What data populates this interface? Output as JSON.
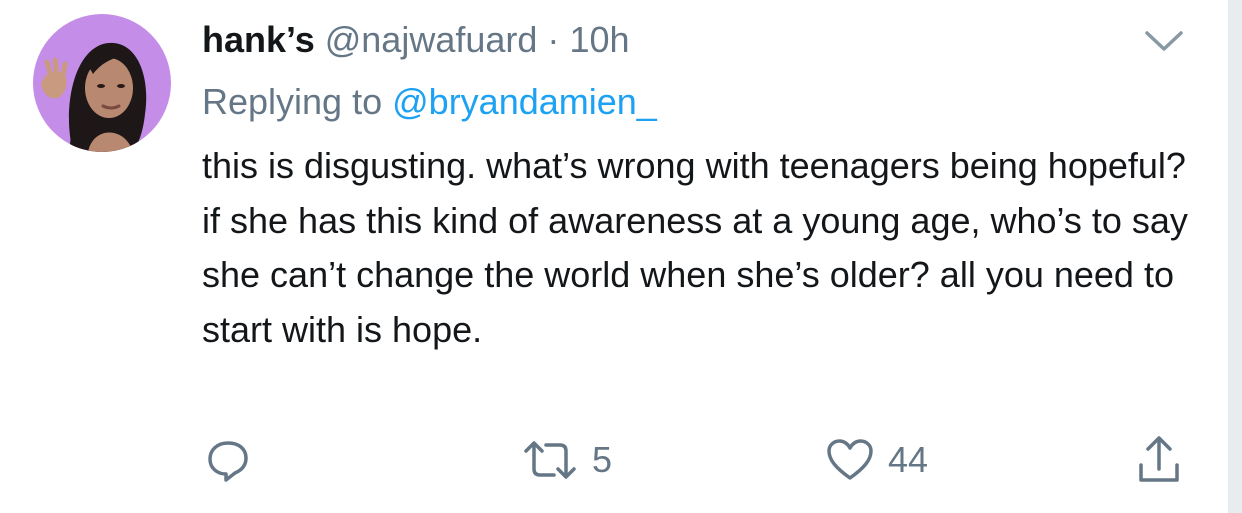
{
  "tweet": {
    "display_name": "hank’s",
    "handle": "@najwafuard",
    "separator": "·",
    "time": "10h",
    "replying_prefix": "Replying to",
    "replying_mention": "@bryandamien_",
    "text": "this is disgusting. what’s wrong with teenagers being hopeful? if she has this kind of awareness at a young age, who’s to say she can’t change the world when she’s older? all you need to start with is hope."
  },
  "actions": {
    "reply_icon": "reply-icon",
    "retweet_icon": "retweet-icon",
    "retweet_count": "5",
    "like_icon": "heart-icon",
    "like_count": "44",
    "share_icon": "share-icon"
  },
  "colors": {
    "name": "#14171a",
    "secondary": "#657786",
    "link": "#1da1f2",
    "avatar_bg": "#c48de8"
  }
}
